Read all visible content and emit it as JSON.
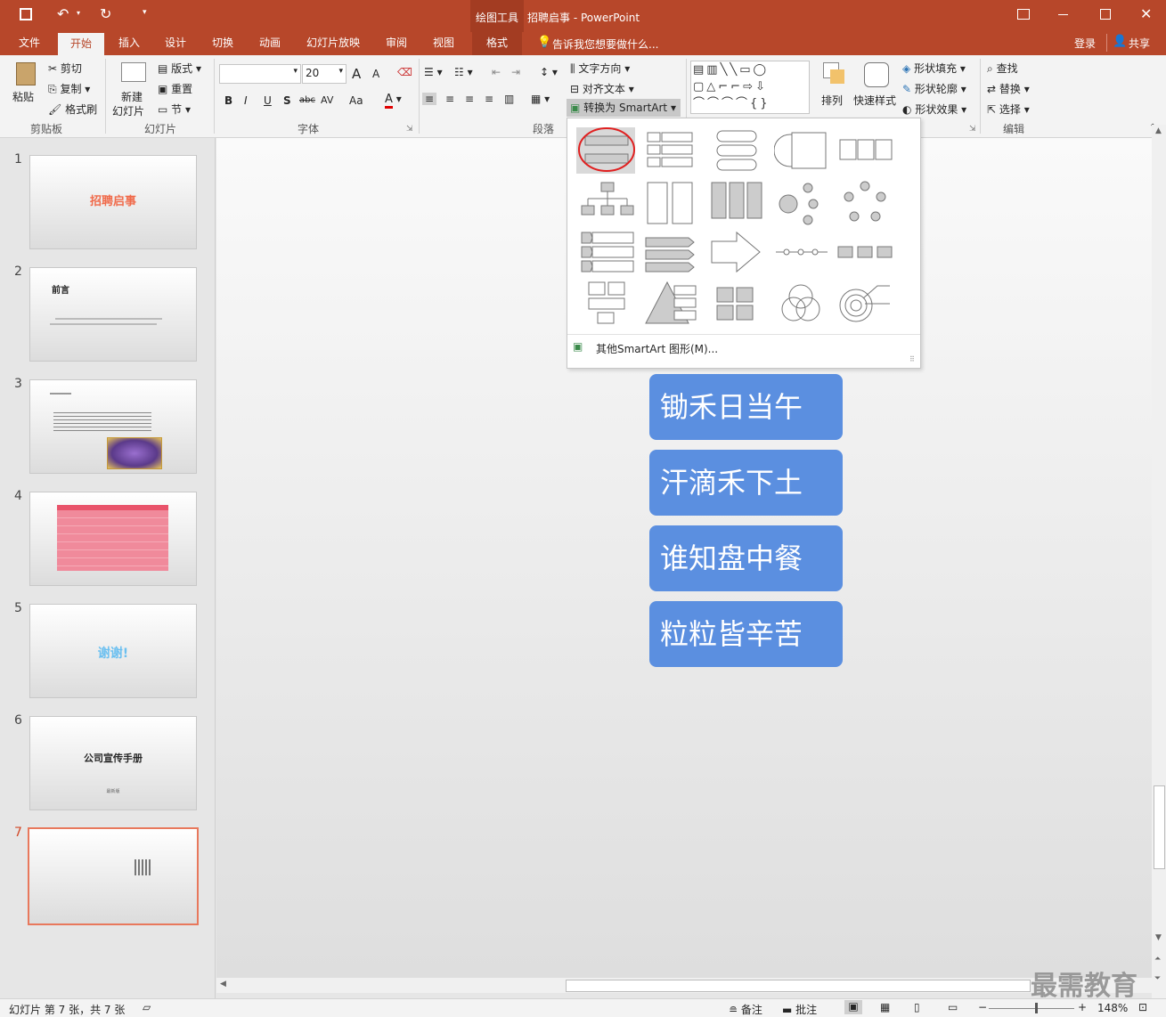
{
  "titlebar": {
    "context_tool": "绘图工具",
    "title": "招聘启事 - PowerPoint",
    "bg_color": "#b7472a"
  },
  "tabs": [
    "文件",
    "开始",
    "插入",
    "设计",
    "切换",
    "动画",
    "幻灯片放映",
    "审阅",
    "视图",
    "格式"
  ],
  "active_tab": "开始",
  "tell_me": "告诉我您想要做什么...",
  "signin": "登录",
  "share": "共享",
  "ribbon": {
    "clipboard": {
      "paste": "粘贴",
      "cut": "剪切",
      "copy": "复制",
      "format_painter": "格式刷",
      "label": "剪贴板"
    },
    "slides": {
      "new_slide_1": "新建",
      "new_slide_2": "幻灯片",
      "layout": "版式",
      "reset": "重置",
      "section": "节",
      "label": "幻灯片"
    },
    "font": {
      "name": "",
      "size": "20",
      "label": "字体",
      "bold": "B",
      "italic": "I",
      "underline": "U",
      "shadow": "S",
      "strike": "abc",
      "spacing": "AV",
      "case": "Aa",
      "color_letter": "A",
      "grow": "A",
      "shrink": "A"
    },
    "paragraph": {
      "text_direction": "文字方向",
      "align_text": "对齐文本",
      "convert_smartart": "转换为 SmartArt",
      "label": "段落"
    },
    "drawing": {
      "arrange": "排列",
      "quick_styles": "快速样式",
      "shape_fill": "形状填充",
      "shape_outline": "形状轮廓",
      "shape_effects": "形状效果"
    },
    "editing": {
      "find": "查找",
      "replace": "替换",
      "select": "选择",
      "label": "编辑"
    }
  },
  "smartart_menu": {
    "more": "其他SmartArt 图形(M)..."
  },
  "thumbnails": [
    {
      "num": "1",
      "title": "招聘启事"
    },
    {
      "num": "2",
      "title": "前言"
    },
    {
      "num": "3",
      "title": ""
    },
    {
      "num": "4",
      "title": ""
    },
    {
      "num": "5",
      "title": "谢谢!"
    },
    {
      "num": "6",
      "title": "公司宣传手册",
      "subtitle": "最新版"
    },
    {
      "num": "7",
      "title": ""
    }
  ],
  "slide": {
    "lines": [
      "锄禾日当午",
      "汗滴禾下土",
      "谁知盘中餐",
      "粒粒皆辛苦"
    ],
    "box_color": "#5b8fe0"
  },
  "status": {
    "slide_info": "幻灯片 第 7 张，共 7 张",
    "notes": "备注",
    "comments": "批注",
    "zoom": "148%"
  },
  "watermark": "最需教育"
}
